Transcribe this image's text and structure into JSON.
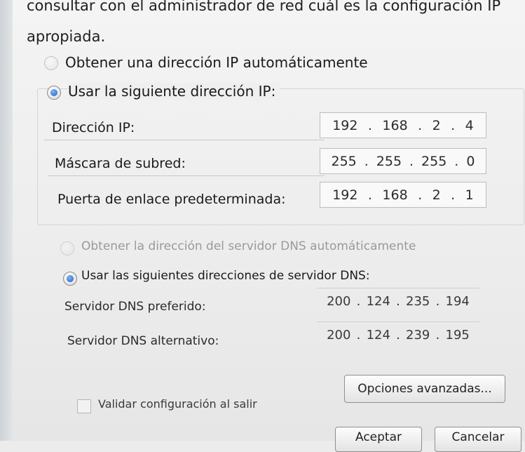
{
  "intro": {
    "line1": "consultar con el administrador de red cuál es la configuración IP",
    "line2": "apropiada."
  },
  "ip": {
    "auto_label": "Obtener una dirección IP automáticamente",
    "manual_label": "Usar la siguiente dirección IP:",
    "address_label": "Dirección IP:",
    "address": [
      "192",
      "168",
      "2",
      "4"
    ],
    "mask_label": "Máscara de subred:",
    "mask": [
      "255",
      "255",
      "255",
      "0"
    ],
    "gateway_label": "Puerta de enlace predeterminada:",
    "gateway": [
      "192",
      "168",
      "2",
      "1"
    ]
  },
  "dns": {
    "auto_label": "Obtener la dirección del servidor DNS automáticamente",
    "manual_label": "Usar las siguientes direcciones de servidor DNS:",
    "preferred_label": "Servidor DNS preferido:",
    "preferred": [
      "200",
      "124",
      "235",
      "194"
    ],
    "alternate_label": "Servidor DNS alternativo:",
    "alternate": [
      "200",
      "124",
      "239",
      "195"
    ]
  },
  "footer": {
    "validate_label": "Validar configuración al salir",
    "advanced_button": "Opciones avanzadas...",
    "accept_button": "Aceptar",
    "cancel_button": "Cancelar"
  },
  "colors": {
    "radio_selected": "#1f5fb8",
    "window_bg": "#ededed"
  }
}
